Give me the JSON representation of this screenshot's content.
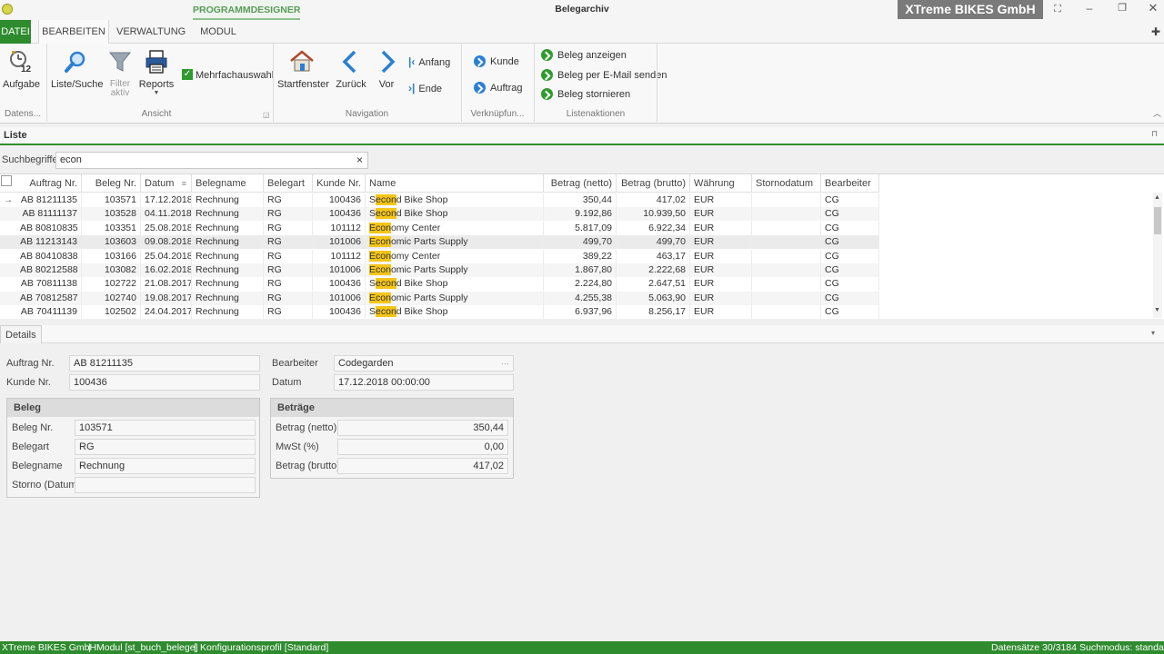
{
  "window": {
    "title": "Belegarchiv",
    "context_tab": "PROGRAMMDESIGNER",
    "company_badge": "XTreme BIKES GmbH"
  },
  "tabs": [
    {
      "label": "DATEI"
    },
    {
      "label": "BEARBEITEN"
    },
    {
      "label": "VERWALTUNG"
    },
    {
      "label": "MODUL"
    }
  ],
  "ribbon": {
    "aufgabe": "Aufgabe",
    "listsuche": "Liste/Suche",
    "filter": "Filter",
    "filter2": "aktiv",
    "reports": "Reports",
    "mehrfach": "Mehrfachauswahl",
    "startfenster": "Startfenster",
    "zurueck": "Zurück",
    "vor": "Vor",
    "anfang": "Anfang",
    "ende": "Ende",
    "kunde": "Kunde",
    "auftrag": "Auftrag",
    "beleg_anzeigen": "Beleg anzeigen",
    "beleg_email": "Beleg per E-Mail senden",
    "beleg_stornieren": "Beleg stornieren",
    "groups": {
      "datens": "Datens...",
      "ansicht": "Ansicht",
      "navigation": "Navigation",
      "verknuepf": "Verknüpfun...",
      "listenaktionen": "Listenaktionen"
    }
  },
  "list": {
    "title": "Liste",
    "search_label": "Suchbegriffe",
    "search_value": "econ",
    "columns": [
      "Auftrag Nr.",
      "Beleg Nr.",
      "Datum",
      "Belegname",
      "Belegart",
      "Kunde Nr.",
      "Name",
      "Betrag (netto)",
      "Betrag (brutto)",
      "Währung",
      "Stornodatum",
      "Bearbeiter"
    ],
    "rows": [
      {
        "auftrag": "AB 81211135",
        "beleg": "103571",
        "datum": "17.12.2018",
        "belegname": "Rechnung",
        "belegart": "RG",
        "kunde": "100436",
        "name_pre": "S",
        "name_hl": "econ",
        "name_post": "d Bike Shop",
        "netto": "350,44",
        "brutto": "417,02",
        "waehrung": "EUR",
        "storno": "",
        "bearbeiter": "CG"
      },
      {
        "auftrag": "AB 81111137",
        "beleg": "103528",
        "datum": "04.11.2018",
        "belegname": "Rechnung",
        "belegart": "RG",
        "kunde": "100436",
        "name_pre": "S",
        "name_hl": "econ",
        "name_post": "d Bike Shop",
        "netto": "9.192,86",
        "brutto": "10.939,50",
        "waehrung": "EUR",
        "storno": "",
        "bearbeiter": "CG"
      },
      {
        "auftrag": "AB 80810835",
        "beleg": "103351",
        "datum": "25.08.2018",
        "belegname": "Rechnung",
        "belegart": "RG",
        "kunde": "101112",
        "name_pre": "",
        "name_hl": "Econ",
        "name_post": "omy Center",
        "netto": "5.817,09",
        "brutto": "6.922,34",
        "waehrung": "EUR",
        "storno": "",
        "bearbeiter": "CG"
      },
      {
        "auftrag": "AB 11213143",
        "beleg": "103603",
        "datum": "09.08.2018",
        "belegname": "Rechnung",
        "belegart": "RG",
        "kunde": "101006",
        "name_pre": "",
        "name_hl": "Econ",
        "name_post": "omic Parts Supply",
        "netto": "499,70",
        "brutto": "499,70",
        "waehrung": "EUR",
        "storno": "",
        "bearbeiter": "CG"
      },
      {
        "auftrag": "AB 80410838",
        "beleg": "103166",
        "datum": "25.04.2018",
        "belegname": "Rechnung",
        "belegart": "RG",
        "kunde": "101112",
        "name_pre": "",
        "name_hl": "Econ",
        "name_post": "omy Center",
        "netto": "389,22",
        "brutto": "463,17",
        "waehrung": "EUR",
        "storno": "",
        "bearbeiter": "CG"
      },
      {
        "auftrag": "AB 80212588",
        "beleg": "103082",
        "datum": "16.02.2018",
        "belegname": "Rechnung",
        "belegart": "RG",
        "kunde": "101006",
        "name_pre": "",
        "name_hl": "Econ",
        "name_post": "omic Parts Supply",
        "netto": "1.867,80",
        "brutto": "2.222,68",
        "waehrung": "EUR",
        "storno": "",
        "bearbeiter": "CG"
      },
      {
        "auftrag": "AB 70811138",
        "beleg": "102722",
        "datum": "21.08.2017",
        "belegname": "Rechnung",
        "belegart": "RG",
        "kunde": "100436",
        "name_pre": "S",
        "name_hl": "econ",
        "name_post": "d Bike Shop",
        "netto": "2.224,80",
        "brutto": "2.647,51",
        "waehrung": "EUR",
        "storno": "",
        "bearbeiter": "CG"
      },
      {
        "auftrag": "AB 70812587",
        "beleg": "102740",
        "datum": "19.08.2017",
        "belegname": "Rechnung",
        "belegart": "RG",
        "kunde": "101006",
        "name_pre": "",
        "name_hl": "Econ",
        "name_post": "omic Parts Supply",
        "netto": "4.255,38",
        "brutto": "5.063,90",
        "waehrung": "EUR",
        "storno": "",
        "bearbeiter": "CG"
      },
      {
        "auftrag": "AB 70411139",
        "beleg": "102502",
        "datum": "24.04.2017",
        "belegname": "Rechnung",
        "belegart": "RG",
        "kunde": "100436",
        "name_pre": "S",
        "name_hl": "econ",
        "name_post": "d Bike Shop",
        "netto": "6.937,96",
        "brutto": "8.256,17",
        "waehrung": "EUR",
        "storno": "",
        "bearbeiter": "CG"
      }
    ]
  },
  "details": {
    "title": "Details",
    "auftrag_label": "Auftrag Nr.",
    "auftrag_value": "AB 81211135",
    "kunde_label": "Kunde Nr.",
    "kunde_value": "100436",
    "bearbeiter_label": "Bearbeiter",
    "bearbeiter_value": "Codegarden",
    "datum_label": "Datum",
    "datum_value": "17.12.2018 00:00:00",
    "beleg_group": {
      "title": "Beleg",
      "belegnr_label": "Beleg Nr.",
      "belegnr_value": "103571",
      "belegart_label": "Belegart",
      "belegart_value": "RG",
      "belegname_label": "Belegname",
      "belegname_value": "Rechnung",
      "storno_label": "Storno (Datum)",
      "storno_value": ""
    },
    "betraege_group": {
      "title": "Beträge",
      "netto_label": "Betrag (netto)",
      "netto_value": "350,44",
      "mwst_label": "MwSt (%)",
      "mwst_value": "0,00",
      "brutto_label": "Betrag (brutto)",
      "brutto_value": "417,02"
    }
  },
  "status": {
    "company": "XTreme BIKES GmbH",
    "sep1": "|",
    "modul": "Modul [st_buch_belege]",
    "sep2": "|",
    "profil": "Konfigurationsprofil [Standard]",
    "records": "Datensätze 30/3184",
    "mode": "Suchmodus: standard"
  },
  "colors": {
    "accent_green": "#2e8b2e",
    "highlight": "#f5c518"
  }
}
